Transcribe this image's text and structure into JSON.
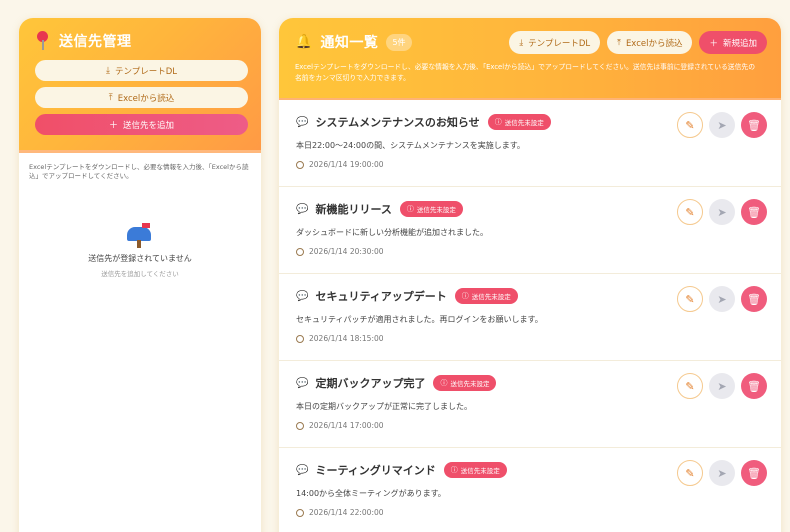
{
  "left": {
    "title": "送信先管理",
    "buttons": {
      "template_dl": "テンプレートDL",
      "excel_import": "Excelから読込",
      "add": "送信先を追加"
    },
    "hint": "Excelテンプレートをダウンロードし、必要な情報を入力後、「Excelから読込」でアップロードしてください。",
    "empty_title": "送信先が登録されていません",
    "empty_sub": "送信先を追加してください"
  },
  "right": {
    "title": "通知一覧",
    "count": "5件",
    "buttons": {
      "template_dl": "テンプレートDL",
      "excel_import": "Excelから読込",
      "new": "新規追加"
    },
    "description": "Excelテンプレートをダウンロードし、必要な情報を入力後、「Excelから読込」でアップロードしてください。送信先は事前に登録されている送信先の名前をカンマ区切りで入力できます。",
    "badge_label": "送信先未設定",
    "notifications": [
      {
        "title": "システムメンテナンスのお知らせ",
        "body": "本日22:00〜24:00の間、システムメンテナンスを実施します。",
        "time": "2026/1/14 19:00:00"
      },
      {
        "title": "新機能リリース",
        "body": "ダッシュボードに新しい分析機能が追加されました。",
        "time": "2026/1/14 20:30:00"
      },
      {
        "title": "セキュリティアップデート",
        "body": "セキュリティパッチが適用されました。再ログインをお願いします。",
        "time": "2026/1/14 18:15:00"
      },
      {
        "title": "定期バックアップ完了",
        "body": "本日の定期バックアップが正常に完了しました。",
        "time": "2026/1/14 17:00:00"
      },
      {
        "title": "ミーティングリマインド",
        "body": "14:00から全体ミーティングがあります。",
        "time": "2026/1/14 22:00:00"
      }
    ]
  },
  "colors": {
    "header_start": "#ffc63a",
    "header_end": "#ff9a45",
    "accent_pink": "#ef4f6a",
    "background": "#fbf6ea"
  },
  "icons": {
    "left_title": "pin-icon",
    "right_title": "bell-icon",
    "download": "download-icon",
    "upload": "upload-icon",
    "plus": "plus-icon",
    "notification": "speech-bubble-icon",
    "badge": "alert-circle-icon",
    "time": "clock-icon",
    "edit": "pencil-icon",
    "send": "send-icon",
    "delete": "trash-icon",
    "empty": "mailbox-icon"
  }
}
